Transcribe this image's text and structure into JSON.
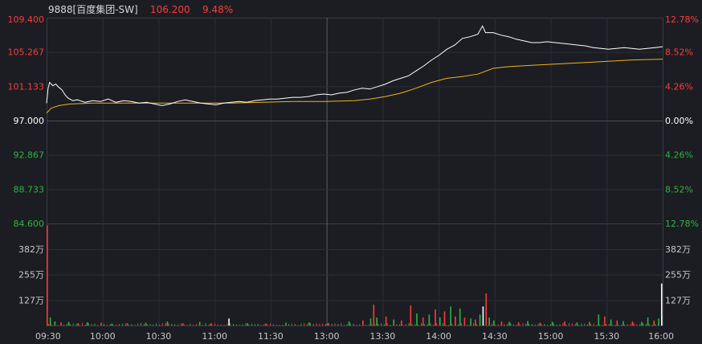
{
  "header": {
    "symbol": "9888[百度集团-SW]",
    "price": "106.200",
    "change_pct": "9.48%"
  },
  "colors": {
    "background": "#1b1d22",
    "grid": "#3a3d44",
    "up": "#ff3b3b",
    "down": "#2fb344",
    "neutral": "#ffffff",
    "price_line": "#ffffff",
    "avg_line": "#f0b31c"
  },
  "chart_data": [
    {
      "type": "line",
      "title": "",
      "x_ticks": [
        "09:30",
        "10:00",
        "10:30",
        "11:00",
        "11:30",
        "13:00",
        "13:30",
        "14:00",
        "14:30",
        "15:00",
        "15:30",
        "16:00"
      ],
      "y_left_ticks": [
        "109.400",
        "105.267",
        "101.133",
        "97.000",
        "92.867",
        "88.733",
        "84.600"
      ],
      "y_right_ticks": [
        "12.78%",
        "8.52%",
        "4.26%",
        "0.00%",
        "4.26%",
        "8.52%",
        "12.78%"
      ],
      "ylim": [
        84.6,
        109.4
      ],
      "prev_close": 97.0,
      "grid": true,
      "series": [
        {
          "key": "price",
          "points": [
            [
              0,
              99.1
            ],
            [
              1,
              100.9
            ],
            [
              2,
              101.6
            ],
            [
              4,
              101.2
            ],
            [
              6,
              101.4
            ],
            [
              8,
              101.0
            ],
            [
              10,
              100.7
            ],
            [
              12,
              100.1
            ],
            [
              14,
              99.7
            ],
            [
              17,
              99.4
            ],
            [
              20,
              99.5
            ],
            [
              25,
              99.2
            ],
            [
              30,
              99.4
            ],
            [
              35,
              99.3
            ],
            [
              40,
              99.6
            ],
            [
              45,
              99.2
            ],
            [
              50,
              99.4
            ],
            [
              55,
              99.3
            ],
            [
              60,
              99.1
            ],
            [
              65,
              99.2
            ],
            [
              70,
              99.0
            ],
            [
              75,
              98.8
            ],
            [
              80,
              99.0
            ],
            [
              85,
              99.3
            ],
            [
              90,
              99.5
            ],
            [
              95,
              99.3
            ],
            [
              100,
              99.1
            ],
            [
              105,
              99.0
            ],
            [
              110,
              98.9
            ],
            [
              115,
              99.1
            ],
            [
              120,
              99.2
            ],
            [
              125,
              99.3
            ],
            [
              130,
              99.2
            ],
            [
              135,
              99.4
            ],
            [
              140,
              99.5
            ],
            [
              145,
              99.6
            ],
            [
              150,
              99.6
            ],
            [
              155,
              99.7
            ],
            [
              160,
              99.8
            ],
            [
              165,
              99.8
            ],
            [
              170,
              99.9
            ],
            [
              175,
              100.1
            ],
            [
              180,
              100.2
            ],
            [
              185,
              100.1
            ],
            [
              190,
              100.3
            ],
            [
              195,
              100.4
            ],
            [
              200,
              100.7
            ],
            [
              205,
              100.9
            ],
            [
              210,
              100.8
            ],
            [
              215,
              101.1
            ],
            [
              220,
              101.4
            ],
            [
              225,
              101.8
            ],
            [
              230,
              102.1
            ],
            [
              235,
              102.4
            ],
            [
              240,
              103.0
            ],
            [
              245,
              103.6
            ],
            [
              250,
              104.3
            ],
            [
              255,
              104.9
            ],
            [
              260,
              105.6
            ],
            [
              265,
              106.1
            ],
            [
              270,
              106.9
            ],
            [
              275,
              107.1
            ],
            [
              280,
              107.4
            ],
            [
              283,
              108.4
            ],
            [
              285,
              107.6
            ],
            [
              290,
              107.6
            ],
            [
              295,
              107.3
            ],
            [
              300,
              107.1
            ],
            [
              305,
              106.8
            ],
            [
              310,
              106.6
            ],
            [
              315,
              106.4
            ],
            [
              320,
              106.4
            ],
            [
              325,
              106.5
            ],
            [
              330,
              106.4
            ],
            [
              335,
              106.3
            ],
            [
              340,
              106.2
            ],
            [
              345,
              106.1
            ],
            [
              350,
              106.0
            ],
            [
              355,
              105.8
            ],
            [
              360,
              105.7
            ],
            [
              365,
              105.6
            ],
            [
              370,
              105.7
            ],
            [
              375,
              105.8
            ],
            [
              380,
              105.7
            ],
            [
              385,
              105.6
            ],
            [
              390,
              105.7
            ],
            [
              395,
              105.8
            ],
            [
              400,
              105.9
            ]
          ]
        },
        {
          "key": "average",
          "points": [
            [
              0,
              97.9
            ],
            [
              3,
              98.5
            ],
            [
              8,
              98.8
            ],
            [
              15,
              99.0
            ],
            [
              30,
              99.1
            ],
            [
              60,
              99.1
            ],
            [
              90,
              99.1
            ],
            [
              120,
              99.1
            ],
            [
              140,
              99.2
            ],
            [
              160,
              99.3
            ],
            [
              180,
              99.3
            ],
            [
              200,
              99.4
            ],
            [
              210,
              99.6
            ],
            [
              220,
              99.9
            ],
            [
              230,
              100.3
            ],
            [
              240,
              100.9
            ],
            [
              250,
              101.6
            ],
            [
              260,
              102.1
            ],
            [
              270,
              102.3
            ],
            [
              280,
              102.6
            ],
            [
              290,
              103.3
            ],
            [
              300,
              103.5
            ],
            [
              320,
              103.7
            ],
            [
              340,
              103.9
            ],
            [
              360,
              104.1
            ],
            [
              380,
              104.3
            ],
            [
              400,
              104.4
            ]
          ]
        }
      ]
    },
    {
      "type": "bar",
      "title": "",
      "y_ticks": [
        "382万",
        "255万",
        "127万"
      ],
      "y_values": [
        382,
        255,
        127
      ],
      "ylim": [
        0,
        510
      ],
      "y_unit": "万",
      "sparse_volume": [
        {
          "x": 0,
          "v": 500,
          "d": "up"
        },
        {
          "x": 2,
          "v": 40,
          "d": "down"
        },
        {
          "x": 5,
          "v": 20,
          "d": "down"
        },
        {
          "x": 9,
          "v": 15,
          "d": "up"
        },
        {
          "x": 14,
          "v": 18,
          "d": "down"
        },
        {
          "x": 20,
          "v": 12,
          "d": "up"
        },
        {
          "x": 26,
          "v": 16,
          "d": "down"
        },
        {
          "x": 35,
          "v": 14,
          "d": "up"
        },
        {
          "x": 42,
          "v": 10,
          "d": "down"
        },
        {
          "x": 52,
          "v": 12,
          "d": "up"
        },
        {
          "x": 64,
          "v": 14,
          "d": "down"
        },
        {
          "x": 78,
          "v": 20,
          "d": "down"
        },
        {
          "x": 88,
          "v": 12,
          "d": "up"
        },
        {
          "x": 99,
          "v": 18,
          "d": "down"
        },
        {
          "x": 106,
          "v": 10,
          "d": "up"
        },
        {
          "x": 118,
          "v": 35,
          "d": "neutral"
        },
        {
          "x": 130,
          "v": 12,
          "d": "down"
        },
        {
          "x": 142,
          "v": 10,
          "d": "up"
        },
        {
          "x": 155,
          "v": 14,
          "d": "down"
        },
        {
          "x": 170,
          "v": 16,
          "d": "down"
        },
        {
          "x": 182,
          "v": 12,
          "d": "up"
        },
        {
          "x": 196,
          "v": 20,
          "d": "down"
        },
        {
          "x": 205,
          "v": 25,
          "d": "up"
        },
        {
          "x": 210,
          "v": 35,
          "d": "down"
        },
        {
          "x": 212,
          "v": 105,
          "d": "up"
        },
        {
          "x": 214,
          "v": 40,
          "d": "down"
        },
        {
          "x": 220,
          "v": 45,
          "d": "up"
        },
        {
          "x": 225,
          "v": 30,
          "d": "down"
        },
        {
          "x": 230,
          "v": 25,
          "d": "up"
        },
        {
          "x": 236,
          "v": 100,
          "d": "up"
        },
        {
          "x": 240,
          "v": 60,
          "d": "down"
        },
        {
          "x": 244,
          "v": 40,
          "d": "up"
        },
        {
          "x": 248,
          "v": 55,
          "d": "down"
        },
        {
          "x": 252,
          "v": 80,
          "d": "up"
        },
        {
          "x": 255,
          "v": 40,
          "d": "down"
        },
        {
          "x": 258,
          "v": 70,
          "d": "up"
        },
        {
          "x": 262,
          "v": 95,
          "d": "down"
        },
        {
          "x": 265,
          "v": 45,
          "d": "up"
        },
        {
          "x": 268,
          "v": 85,
          "d": "down"
        },
        {
          "x": 271,
          "v": 40,
          "d": "up"
        },
        {
          "x": 275,
          "v": 35,
          "d": "down"
        },
        {
          "x": 278,
          "v": 30,
          "d": "up"
        },
        {
          "x": 281,
          "v": 55,
          "d": "down"
        },
        {
          "x": 283,
          "v": 95,
          "d": "neutral"
        },
        {
          "x": 285,
          "v": 160,
          "d": "up"
        },
        {
          "x": 287,
          "v": 40,
          "d": "down"
        },
        {
          "x": 290,
          "v": 25,
          "d": "down"
        },
        {
          "x": 295,
          "v": 20,
          "d": "up"
        },
        {
          "x": 300,
          "v": 18,
          "d": "down"
        },
        {
          "x": 306,
          "v": 16,
          "d": "up"
        },
        {
          "x": 312,
          "v": 22,
          "d": "down"
        },
        {
          "x": 320,
          "v": 14,
          "d": "up"
        },
        {
          "x": 328,
          "v": 18,
          "d": "down"
        },
        {
          "x": 336,
          "v": 20,
          "d": "up"
        },
        {
          "x": 344,
          "v": 15,
          "d": "down"
        },
        {
          "x": 352,
          "v": 18,
          "d": "up"
        },
        {
          "x": 358,
          "v": 55,
          "d": "down"
        },
        {
          "x": 362,
          "v": 45,
          "d": "up"
        },
        {
          "x": 366,
          "v": 30,
          "d": "down"
        },
        {
          "x": 370,
          "v": 25,
          "d": "up"
        },
        {
          "x": 374,
          "v": 22,
          "d": "down"
        },
        {
          "x": 380,
          "v": 20,
          "d": "up"
        },
        {
          "x": 386,
          "v": 18,
          "d": "down"
        },
        {
          "x": 390,
          "v": 40,
          "d": "down"
        },
        {
          "x": 394,
          "v": 25,
          "d": "up"
        },
        {
          "x": 397,
          "v": 35,
          "d": "down"
        },
        {
          "x": 399,
          "v": 55,
          "d": "down"
        },
        {
          "x": 400,
          "v": 210,
          "d": "neutral"
        }
      ]
    }
  ]
}
